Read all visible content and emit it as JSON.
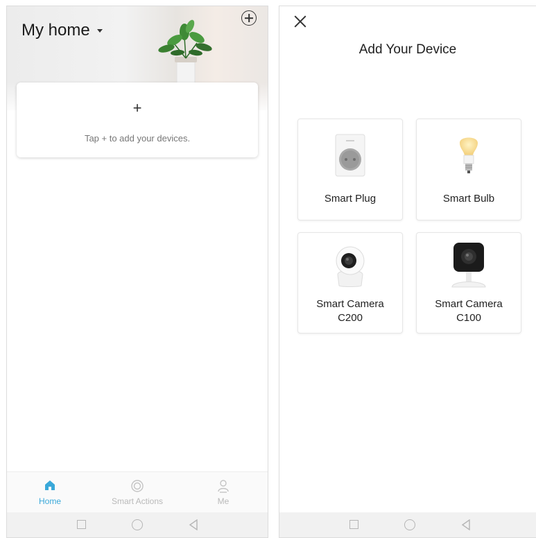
{
  "home_screen": {
    "title": "My home",
    "add_hint": "Tap + to add your devices.",
    "add_symbol": "+",
    "tabs": [
      {
        "label": "Home",
        "icon": "home-icon",
        "active": true
      },
      {
        "label": "Smart Actions",
        "icon": "smart-actions-icon",
        "active": false
      },
      {
        "label": "Me",
        "icon": "person-icon",
        "active": false
      }
    ]
  },
  "add_device_screen": {
    "title": "Add Your Device",
    "devices": [
      {
        "name": "Smart Plug",
        "subtitle": "",
        "icon": "smart-plug-image"
      },
      {
        "name": "Smart Bulb",
        "subtitle": "",
        "icon": "smart-bulb-image"
      },
      {
        "name": "Smart Camera",
        "subtitle": "C200",
        "icon": "camera-c200-image"
      },
      {
        "name": "Smart Camera",
        "subtitle": "C100",
        "icon": "camera-c100-image"
      }
    ]
  },
  "colors": {
    "accent": "#3aa8d9",
    "inactive": "#b9b9b9"
  }
}
